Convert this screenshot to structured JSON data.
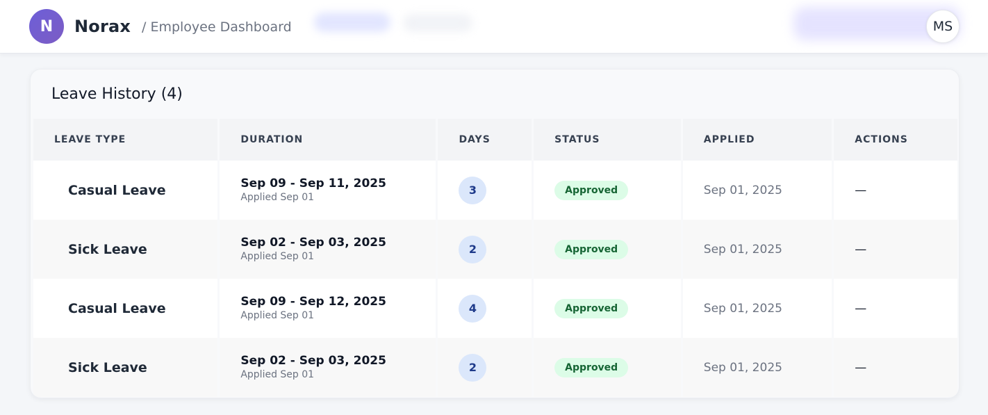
{
  "header": {
    "logo_letter": "N",
    "brand": "Norax",
    "breadcrumb": "/ Employee Dashboard",
    "avatar_initials": "MS"
  },
  "card": {
    "title": "Leave History (4)"
  },
  "table": {
    "columns": [
      "LEAVE TYPE",
      "DURATION",
      "DAYS",
      "STATUS",
      "APPLIED",
      "ACTIONS"
    ],
    "rows": [
      {
        "type": "Casual Leave",
        "duration": "Sep 09 - Sep 11, 2025",
        "duration_sub": "Applied Sep 01",
        "days": "3",
        "status": "Approved",
        "applied": "Sep 01, 2025",
        "actions": "—"
      },
      {
        "type": "Sick Leave",
        "duration": "Sep 02 - Sep 03, 2025",
        "duration_sub": "Applied Sep 01",
        "days": "2",
        "status": "Approved",
        "applied": "Sep 01, 2025",
        "actions": "—"
      },
      {
        "type": "Casual Leave",
        "duration": "Sep 09 - Sep 12, 2025",
        "duration_sub": "Applied Sep 01",
        "days": "4",
        "status": "Approved",
        "applied": "Sep 01, 2025",
        "actions": "—"
      },
      {
        "type": "Sick Leave",
        "duration": "Sep 02 - Sep 03, 2025",
        "duration_sub": "Applied Sep 01",
        "days": "2",
        "status": "Approved",
        "applied": "Sep 01, 2025",
        "actions": "—"
      }
    ]
  },
  "colors": {
    "accent": "#6d5fd8",
    "status_approved_bg": "#dcfce7",
    "status_approved_text": "#166534",
    "days_badge_bg": "#dbe7fb"
  }
}
